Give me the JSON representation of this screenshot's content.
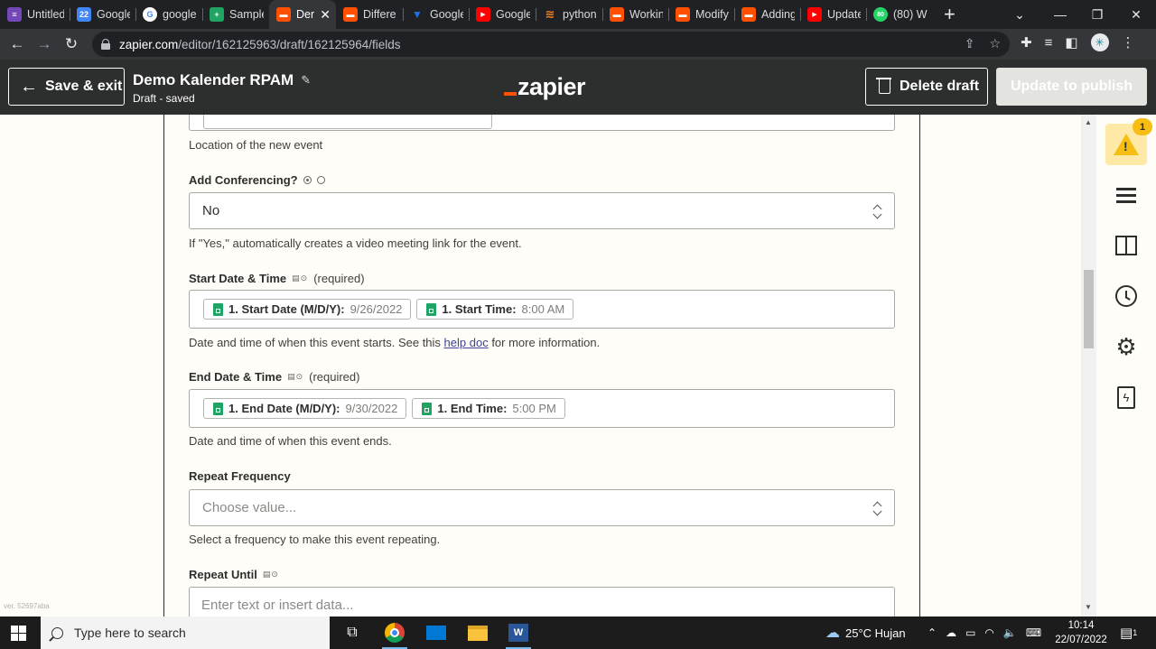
{
  "browser": {
    "tabs": [
      {
        "label": "Untitled",
        "color": "#7248b9",
        "glyph": "≡"
      },
      {
        "label": "Google",
        "color": "#4285f4",
        "glyph": "22"
      },
      {
        "label": "google",
        "color": "#ffffff",
        "glyph": "G"
      },
      {
        "label": "Sample",
        "color": "#1fa463",
        "glyph": "+"
      },
      {
        "label": "Den",
        "color": "#ff4f00",
        "glyph": "▬",
        "active": true
      },
      {
        "label": "Differe",
        "color": "#ff4f00",
        "glyph": "▬"
      },
      {
        "label": "Google",
        "color": "#1a73e8",
        "glyph": "▼"
      },
      {
        "label": "Google",
        "color": "#ff0000",
        "glyph": "▶"
      },
      {
        "label": "python",
        "color": "#f48024",
        "glyph": "≋"
      },
      {
        "label": "Workin",
        "color": "#ff4f00",
        "glyph": "▬"
      },
      {
        "label": "Modify",
        "color": "#ff4f00",
        "glyph": "▬"
      },
      {
        "label": "Adding",
        "color": "#ff4f00",
        "glyph": "▬"
      },
      {
        "label": "Update",
        "color": "#ff0000",
        "glyph": "▶"
      },
      {
        "label": "(80) W",
        "color": "#25d366",
        "glyph": "80"
      }
    ],
    "url_host": "zapier.com",
    "url_path": "/editor/162125963/draft/162125964/fields"
  },
  "header": {
    "save_exit": "Save & exit",
    "title": "Demo Kalender RPAM",
    "status": "Draft - saved",
    "logo": "zapier",
    "delete_draft": "Delete draft",
    "publish": "Update to publish"
  },
  "form": {
    "location_help": "Location of the new event",
    "conferencing": {
      "label": "Add Conferencing?",
      "value": "No",
      "help": "If \"Yes,\" automatically creates a video meeting link for the event."
    },
    "start": {
      "label": "Start Date & Time",
      "required": "(required)",
      "pill1_key": "1. Start Date (M/D/Y):",
      "pill1_val": "9/26/2022",
      "pill2_key": "1. Start Time:",
      "pill2_val": "8:00 AM",
      "help_pre": "Date and time of when this event starts. See this ",
      "help_link": "help doc",
      "help_post": " for more information."
    },
    "end": {
      "label": "End Date & Time",
      "required": "(required)",
      "pill1_key": "1. End Date (M/D/Y):",
      "pill1_val": "9/30/2022",
      "pill2_key": "1. End Time:",
      "pill2_val": "5:00 PM",
      "help": "Date and time of when this event ends."
    },
    "repeat_frequency": {
      "label": "Repeat Frequency",
      "placeholder": "Choose value...",
      "help": "Select a frequency to make this event repeating."
    },
    "repeat_until": {
      "label": "Repeat Until",
      "placeholder": "Enter text or insert data..."
    }
  },
  "version": "ver. 52697aba",
  "sidebar": {
    "badge_count": "1"
  },
  "taskbar": {
    "search_placeholder": "Type here to search",
    "weather": "25°C  Hujan",
    "time": "10:14",
    "date": "22/07/2022",
    "notification_count": "1"
  }
}
